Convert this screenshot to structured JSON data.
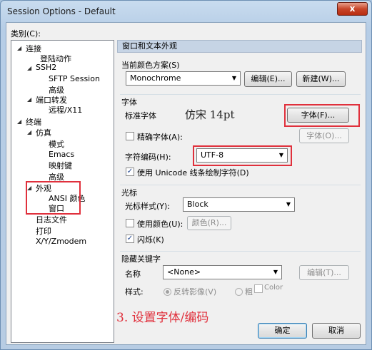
{
  "window": {
    "title": "Session Options - Default",
    "close_glyph": "x"
  },
  "category": {
    "label": "类别(C):",
    "tree": [
      {
        "label": "连接",
        "expanded": true
      },
      {
        "label": "登陆动作"
      },
      {
        "label": "SSH2",
        "expanded": true
      },
      {
        "label": "SFTP Session"
      },
      {
        "label": "高级"
      },
      {
        "label": "端口转发",
        "expanded": true
      },
      {
        "label": "远程/X11"
      },
      {
        "label": "终端",
        "expanded": true
      },
      {
        "label": "仿真",
        "expanded": true
      },
      {
        "label": "模式"
      },
      {
        "label": "Emacs"
      },
      {
        "label": "映射键"
      },
      {
        "label": "高级"
      },
      {
        "label": "外观",
        "expanded": true,
        "selected": true
      },
      {
        "label": "ANSI 颜色"
      },
      {
        "label": "窗口"
      },
      {
        "label": "日志文件"
      },
      {
        "label": "打印"
      },
      {
        "label": "X/Y/Zmodem"
      }
    ]
  },
  "panel": {
    "header": "窗口和文本外观",
    "color_scheme": {
      "label": "当前颜色方案(S)",
      "value": "Monochrome",
      "edit_button": "编辑(E)...",
      "new_button": "新建(W)..."
    },
    "font": {
      "group_label": "字体",
      "standard_font_label": "标准字体",
      "standard_font_value": "仿宋 14pt",
      "font_button": "字体(F)...",
      "precise_font_label": "精确字体(A):",
      "precise_font_checked": false,
      "precise_font_button": "字体(O)...",
      "encoding_label": "字符编码(H):",
      "encoding_value": "UTF-8",
      "unicode_line_label": "使用 Unicode 线条绘制字符(D)",
      "unicode_line_checked": true
    },
    "cursor": {
      "group_label": "光标",
      "style_label": "光标样式(Y):",
      "style_value": "Block",
      "use_color_label": "使用颜色(U):",
      "use_color_checked": false,
      "color_button": "颜色(R)...",
      "blink_label": "闪烁(K)",
      "blink_checked": true
    },
    "keywords": {
      "group_label": "隐藏关键字",
      "name_label": "名称",
      "name_value": "<None>",
      "edit_button": "编辑(T)...",
      "style_label": "样式:",
      "reverse_label": "反转影像(V)",
      "bold_label": "粗",
      "color_label": "Color"
    }
  },
  "annotation": "3. 设置字体/编码",
  "buttons": {
    "ok": "确定",
    "cancel": "取消"
  },
  "colors": {
    "highlight": "#e0303c",
    "annotation_text": "#e0303c",
    "header_bg": "#c6d4e5"
  }
}
